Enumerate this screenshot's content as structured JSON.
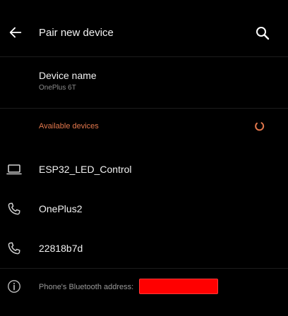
{
  "colors": {
    "background": "#000000",
    "primary_text": "#f2f2f2",
    "secondary_text": "#8c8c8c",
    "accent": "#e2774c",
    "redaction": "#ff0000"
  },
  "appbar": {
    "title": "Pair new device",
    "back_icon": "arrow-left-icon",
    "search_icon": "search-icon"
  },
  "device_name": {
    "title": "Device name",
    "value": "OnePlus 6T"
  },
  "available": {
    "header": "Available devices",
    "spinner_icon": "loading-spinner-icon"
  },
  "devices": [
    {
      "name": "ESP32_LED_Control",
      "icon": "laptop-icon"
    },
    {
      "name": "OnePlus2",
      "icon": "phone-icon"
    },
    {
      "name": "22818b7d",
      "icon": "phone-icon"
    }
  ],
  "footer": {
    "text": "Phone's Bluetooth address:",
    "info_icon": "info-icon"
  }
}
